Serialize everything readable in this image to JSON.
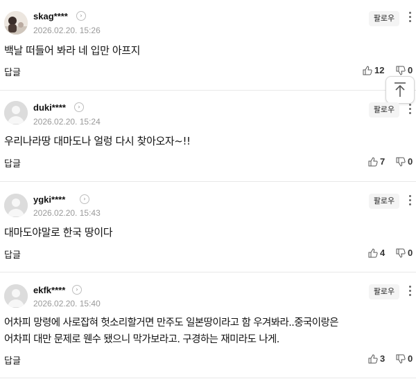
{
  "comments": [
    {
      "nickname": "skag****",
      "date": "2026.02.20. 15:26",
      "follow_label": "팔로우",
      "text": "백날 떠들어 봐라 네 입만 아프지",
      "reply_label": "답글",
      "likes": "12",
      "dislikes": "0"
    },
    {
      "nickname": "duki****",
      "date": "2026.02.20. 15:24",
      "follow_label": "팔로우",
      "text": "우리나라땅 대마도나 얼렁 다시 찾아오자~!!",
      "reply_label": "답글",
      "likes": "7",
      "dislikes": "0"
    },
    {
      "nickname": "ygki****",
      "date": "2026.02.20. 15:43",
      "follow_label": "팔로우",
      "text": "대마도야말로 한국 땅이다",
      "reply_label": "답글",
      "likes": "4",
      "dislikes": "0"
    },
    {
      "nickname": "ekfk****",
      "date": "2026.02.20. 15:40",
      "follow_label": "팔로우",
      "text_line1": "어차피 망령에 사로잡혀 헛소리할거면 만주도 일본땅이라고 함 우겨봐라..중국이랑은",
      "text_line2": "어차피 대만 문제로 웬수 됐으니 막가보라고. 구경하는 재미라도 나게.",
      "reply_label": "답글",
      "likes": "3",
      "dislikes": "0"
    }
  ],
  "icons": {
    "like": "thumbs-up-icon",
    "dislike": "thumbs-down-icon",
    "more": "kebab-menu-icon",
    "profile_arrow": "chevron-right-icon",
    "scroll_top": "arrow-up-to-top-icon"
  }
}
